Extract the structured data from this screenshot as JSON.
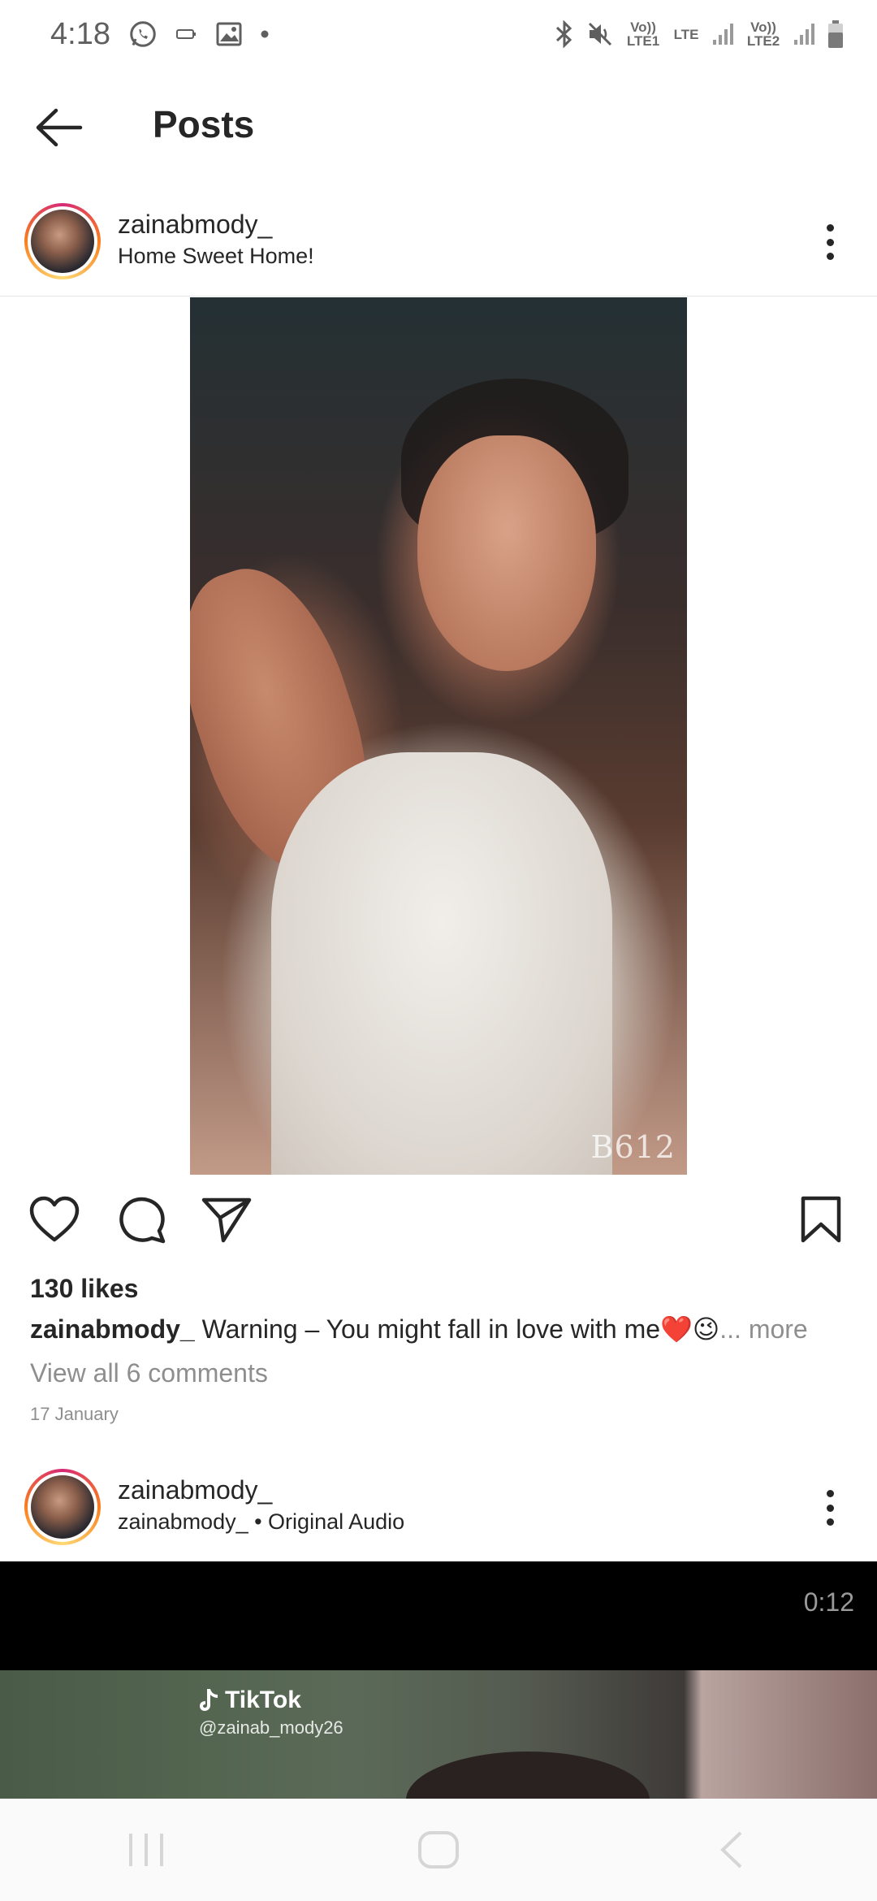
{
  "status_bar": {
    "time": "4:18",
    "left_icons": [
      "whatsapp-icon",
      "battery-saver-icon",
      "image-icon",
      "dot-icon"
    ],
    "network_labels": [
      "Vo)) LTE1",
      "LTE",
      "Vo)) LTE2"
    ]
  },
  "header": {
    "title": "Posts"
  },
  "post1": {
    "username": "zainabmody_",
    "location": "Home Sweet Home!",
    "watermark": "B612",
    "likes": "130 likes",
    "caption_user": "zainabmody_",
    "caption_text": "Warning – You might fall in love with me❤️😉",
    "caption_more": "... more",
    "view_comments": "View all 6 comments",
    "date": "17 January"
  },
  "post2": {
    "username": "zainabmody_",
    "audio": "zainabmody_ • Original Audio",
    "video_time": "0:12",
    "tiktok_brand": "TikTok",
    "tiktok_handle": "@zainab_mody26"
  },
  "colors": {
    "text": "#262626",
    "muted": "#8e8e8e",
    "story_ring_start": "#d62976",
    "story_ring_end": "#fa7e1e"
  }
}
